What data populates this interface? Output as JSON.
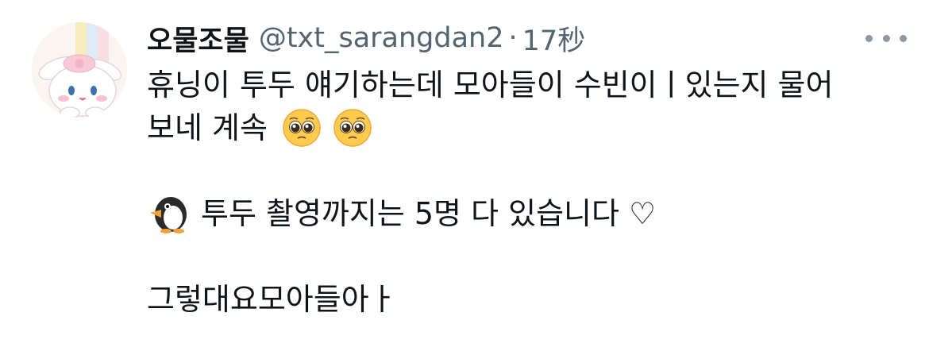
{
  "tweet": {
    "display_name": "오물조물",
    "handle": "@txt_sarangdan2",
    "separator": "·",
    "time": "17秒",
    "lines": {
      "l1": "휴닝이 투두 얘기하는데 모아들이 수빈이ㅣ있는지 물어",
      "l2": "보네 계속",
      "l3": "투두 촬영까지는 5명 다 있습니다 ♡",
      "l4": "그렇대요모아들아ㅏ"
    },
    "icons": {
      "avatar": "cinnamoroll-avatar",
      "more": "more-options-icon",
      "pleading": "pleading-face-emoji",
      "penguin": "penguin-emoji"
    }
  }
}
